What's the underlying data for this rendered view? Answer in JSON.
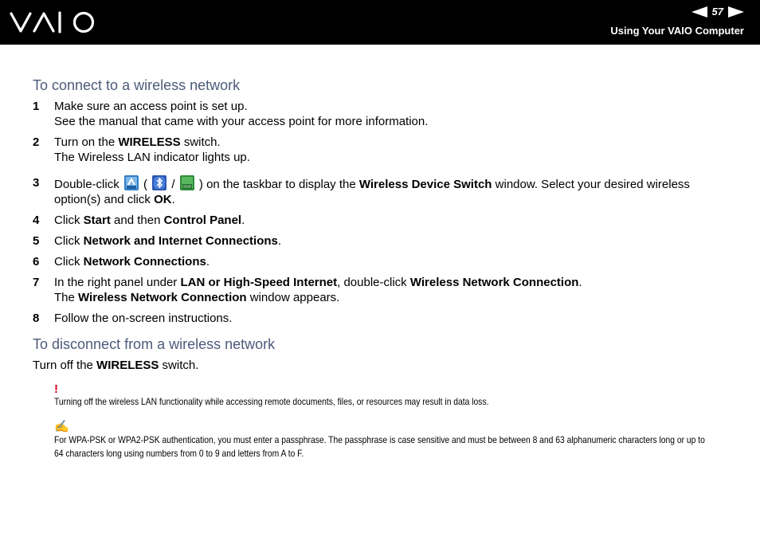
{
  "header": {
    "logo_text": "VAIO",
    "page_number": "57",
    "title": "Using Your VAIO Computer"
  },
  "section1": {
    "heading": "To connect to a wireless network",
    "steps": [
      {
        "num": "1",
        "lines": [
          "Make sure an access point is set up.",
          "See the manual that came with your access point for more information."
        ]
      },
      {
        "num": "2",
        "pre": "Turn on the ",
        "bold": "WIRELESS",
        "post": " switch.",
        "line2": "The Wireless LAN indicator lights up."
      },
      {
        "num": "3",
        "text_a": "Double-click",
        "paren_open": "(",
        "slash": "/",
        "text_b": ") on the taskbar to display the ",
        "bold_a": "Wireless Device Switch",
        "text_c": " window. Select your desired wireless option(s) and click ",
        "bold_b": "OK",
        "end": "."
      },
      {
        "num": "4",
        "pre": "Click ",
        "bold_a": "Start",
        "mid": " and then ",
        "bold_b": "Control Panel",
        "end": "."
      },
      {
        "num": "5",
        "pre": "Click ",
        "bold": "Network and Internet Connections",
        "end": "."
      },
      {
        "num": "6",
        "pre": "Click ",
        "bold": "Network Connections",
        "end": "."
      },
      {
        "num": "7",
        "pre": "In the right panel under ",
        "bold_a": "LAN or High-Speed Internet",
        "mid": ", double-click ",
        "bold_b": "Wireless Network Connection",
        "end": ".",
        "line2_pre": "The ",
        "line2_bold": "Wireless Network Connection",
        "line2_post": " window appears."
      },
      {
        "num": "8",
        "text": "Follow the on-screen instructions."
      }
    ]
  },
  "section2": {
    "heading": "To disconnect from a wireless network",
    "pre": "Turn off the ",
    "bold": "WIRELESS",
    "post": " switch."
  },
  "notes": {
    "warning_mark": "!",
    "warning_text": "Turning off the wireless LAN functionality while accessing remote documents, files, or resources may result in data loss.",
    "pen_mark": "✍",
    "info_text": "For WPA-PSK or WPA2-PSK authentication, you must enter a passphrase. The passphrase is case sensitive and must be between 8 and 63 alphanumeric characters long or up to 64 characters long using numbers from 0 to 9 and letters from A to F."
  },
  "icons": {
    "prev": "left-arrow-icon",
    "next": "right-arrow-icon",
    "wireless_lan_switch": "wireless-lan-switch-icon",
    "bluetooth_switch": "bluetooth-switch-icon",
    "lan_switch": "lan-switch-icon"
  },
  "colors": {
    "header_bg": "#000000",
    "heading": "#4d5b7a",
    "warning": "#d6001c",
    "note_pen": "#4d6ca8"
  }
}
